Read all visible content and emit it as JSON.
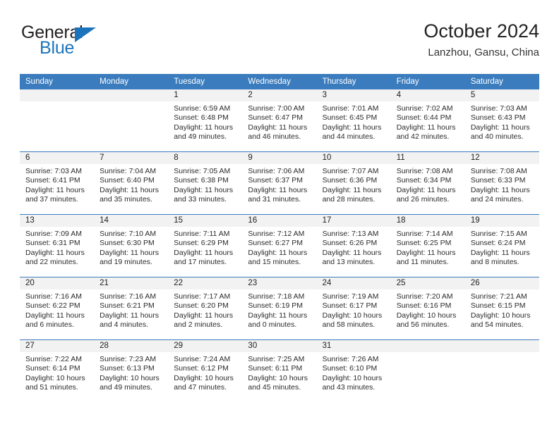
{
  "brand": {
    "name_part1": "General",
    "name_part2": "Blue",
    "flag_icon": "triangle-flag-icon",
    "accent_color": "#1b74bb"
  },
  "header": {
    "title": "October 2024",
    "subtitle": "Lanzhou, Gansu, China"
  },
  "calendar": {
    "header_bg": "#3a7cbe",
    "daynum_bg": "#f2f2f2",
    "weekdays": [
      "Sunday",
      "Monday",
      "Tuesday",
      "Wednesday",
      "Thursday",
      "Friday",
      "Saturday"
    ],
    "weeks": [
      [
        {
          "day": "",
          "sunrise": "",
          "sunset": "",
          "daylight_line1": "",
          "daylight_line2": ""
        },
        {
          "day": "",
          "sunrise": "",
          "sunset": "",
          "daylight_line1": "",
          "daylight_line2": ""
        },
        {
          "day": "1",
          "sunrise": "Sunrise: 6:59 AM",
          "sunset": "Sunset: 6:48 PM",
          "daylight_line1": "Daylight: 11 hours",
          "daylight_line2": "and 49 minutes."
        },
        {
          "day": "2",
          "sunrise": "Sunrise: 7:00 AM",
          "sunset": "Sunset: 6:47 PM",
          "daylight_line1": "Daylight: 11 hours",
          "daylight_line2": "and 46 minutes."
        },
        {
          "day": "3",
          "sunrise": "Sunrise: 7:01 AM",
          "sunset": "Sunset: 6:45 PM",
          "daylight_line1": "Daylight: 11 hours",
          "daylight_line2": "and 44 minutes."
        },
        {
          "day": "4",
          "sunrise": "Sunrise: 7:02 AM",
          "sunset": "Sunset: 6:44 PM",
          "daylight_line1": "Daylight: 11 hours",
          "daylight_line2": "and 42 minutes."
        },
        {
          "day": "5",
          "sunrise": "Sunrise: 7:03 AM",
          "sunset": "Sunset: 6:43 PM",
          "daylight_line1": "Daylight: 11 hours",
          "daylight_line2": "and 40 minutes."
        }
      ],
      [
        {
          "day": "6",
          "sunrise": "Sunrise: 7:03 AM",
          "sunset": "Sunset: 6:41 PM",
          "daylight_line1": "Daylight: 11 hours",
          "daylight_line2": "and 37 minutes."
        },
        {
          "day": "7",
          "sunrise": "Sunrise: 7:04 AM",
          "sunset": "Sunset: 6:40 PM",
          "daylight_line1": "Daylight: 11 hours",
          "daylight_line2": "and 35 minutes."
        },
        {
          "day": "8",
          "sunrise": "Sunrise: 7:05 AM",
          "sunset": "Sunset: 6:38 PM",
          "daylight_line1": "Daylight: 11 hours",
          "daylight_line2": "and 33 minutes."
        },
        {
          "day": "9",
          "sunrise": "Sunrise: 7:06 AM",
          "sunset": "Sunset: 6:37 PM",
          "daylight_line1": "Daylight: 11 hours",
          "daylight_line2": "and 31 minutes."
        },
        {
          "day": "10",
          "sunrise": "Sunrise: 7:07 AM",
          "sunset": "Sunset: 6:36 PM",
          "daylight_line1": "Daylight: 11 hours",
          "daylight_line2": "and 28 minutes."
        },
        {
          "day": "11",
          "sunrise": "Sunrise: 7:08 AM",
          "sunset": "Sunset: 6:34 PM",
          "daylight_line1": "Daylight: 11 hours",
          "daylight_line2": "and 26 minutes."
        },
        {
          "day": "12",
          "sunrise": "Sunrise: 7:08 AM",
          "sunset": "Sunset: 6:33 PM",
          "daylight_line1": "Daylight: 11 hours",
          "daylight_line2": "and 24 minutes."
        }
      ],
      [
        {
          "day": "13",
          "sunrise": "Sunrise: 7:09 AM",
          "sunset": "Sunset: 6:31 PM",
          "daylight_line1": "Daylight: 11 hours",
          "daylight_line2": "and 22 minutes."
        },
        {
          "day": "14",
          "sunrise": "Sunrise: 7:10 AM",
          "sunset": "Sunset: 6:30 PM",
          "daylight_line1": "Daylight: 11 hours",
          "daylight_line2": "and 19 minutes."
        },
        {
          "day": "15",
          "sunrise": "Sunrise: 7:11 AM",
          "sunset": "Sunset: 6:29 PM",
          "daylight_line1": "Daylight: 11 hours",
          "daylight_line2": "and 17 minutes."
        },
        {
          "day": "16",
          "sunrise": "Sunrise: 7:12 AM",
          "sunset": "Sunset: 6:27 PM",
          "daylight_line1": "Daylight: 11 hours",
          "daylight_line2": "and 15 minutes."
        },
        {
          "day": "17",
          "sunrise": "Sunrise: 7:13 AM",
          "sunset": "Sunset: 6:26 PM",
          "daylight_line1": "Daylight: 11 hours",
          "daylight_line2": "and 13 minutes."
        },
        {
          "day": "18",
          "sunrise": "Sunrise: 7:14 AM",
          "sunset": "Sunset: 6:25 PM",
          "daylight_line1": "Daylight: 11 hours",
          "daylight_line2": "and 11 minutes."
        },
        {
          "day": "19",
          "sunrise": "Sunrise: 7:15 AM",
          "sunset": "Sunset: 6:24 PM",
          "daylight_line1": "Daylight: 11 hours",
          "daylight_line2": "and 8 minutes."
        }
      ],
      [
        {
          "day": "20",
          "sunrise": "Sunrise: 7:16 AM",
          "sunset": "Sunset: 6:22 PM",
          "daylight_line1": "Daylight: 11 hours",
          "daylight_line2": "and 6 minutes."
        },
        {
          "day": "21",
          "sunrise": "Sunrise: 7:16 AM",
          "sunset": "Sunset: 6:21 PM",
          "daylight_line1": "Daylight: 11 hours",
          "daylight_line2": "and 4 minutes."
        },
        {
          "day": "22",
          "sunrise": "Sunrise: 7:17 AM",
          "sunset": "Sunset: 6:20 PM",
          "daylight_line1": "Daylight: 11 hours",
          "daylight_line2": "and 2 minutes."
        },
        {
          "day": "23",
          "sunrise": "Sunrise: 7:18 AM",
          "sunset": "Sunset: 6:19 PM",
          "daylight_line1": "Daylight: 11 hours",
          "daylight_line2": "and 0 minutes."
        },
        {
          "day": "24",
          "sunrise": "Sunrise: 7:19 AM",
          "sunset": "Sunset: 6:17 PM",
          "daylight_line1": "Daylight: 10 hours",
          "daylight_line2": "and 58 minutes."
        },
        {
          "day": "25",
          "sunrise": "Sunrise: 7:20 AM",
          "sunset": "Sunset: 6:16 PM",
          "daylight_line1": "Daylight: 10 hours",
          "daylight_line2": "and 56 minutes."
        },
        {
          "day": "26",
          "sunrise": "Sunrise: 7:21 AM",
          "sunset": "Sunset: 6:15 PM",
          "daylight_line1": "Daylight: 10 hours",
          "daylight_line2": "and 54 minutes."
        }
      ],
      [
        {
          "day": "27",
          "sunrise": "Sunrise: 7:22 AM",
          "sunset": "Sunset: 6:14 PM",
          "daylight_line1": "Daylight: 10 hours",
          "daylight_line2": "and 51 minutes."
        },
        {
          "day": "28",
          "sunrise": "Sunrise: 7:23 AM",
          "sunset": "Sunset: 6:13 PM",
          "daylight_line1": "Daylight: 10 hours",
          "daylight_line2": "and 49 minutes."
        },
        {
          "day": "29",
          "sunrise": "Sunrise: 7:24 AM",
          "sunset": "Sunset: 6:12 PM",
          "daylight_line1": "Daylight: 10 hours",
          "daylight_line2": "and 47 minutes."
        },
        {
          "day": "30",
          "sunrise": "Sunrise: 7:25 AM",
          "sunset": "Sunset: 6:11 PM",
          "daylight_line1": "Daylight: 10 hours",
          "daylight_line2": "and 45 minutes."
        },
        {
          "day": "31",
          "sunrise": "Sunrise: 7:26 AM",
          "sunset": "Sunset: 6:10 PM",
          "daylight_line1": "Daylight: 10 hours",
          "daylight_line2": "and 43 minutes."
        },
        {
          "day": "",
          "sunrise": "",
          "sunset": "",
          "daylight_line1": "",
          "daylight_line2": ""
        },
        {
          "day": "",
          "sunrise": "",
          "sunset": "",
          "daylight_line1": "",
          "daylight_line2": ""
        }
      ]
    ]
  }
}
